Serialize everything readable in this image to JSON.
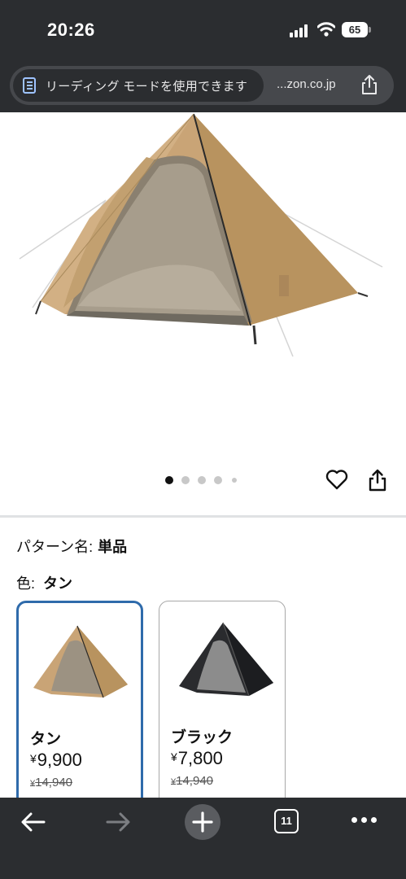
{
  "status_bar": {
    "time": "20:26",
    "battery": "65",
    "icons": [
      "signal-icon",
      "wifi-icon",
      "battery-icon"
    ]
  },
  "address_bar": {
    "reader_mode_label": "リーディング モードを使用できます",
    "domain": "...zon.co.jp",
    "icons": [
      "reader-mode-icon",
      "share-icon"
    ]
  },
  "product": {
    "image": "tent-image",
    "carousel": {
      "count": 5,
      "active_index": 0
    },
    "actions": [
      "heart-icon",
      "share-icon"
    ]
  },
  "details": {
    "pattern_label": "パターン名:",
    "pattern_value": "単品",
    "color_label": "色:",
    "color_value": "タン"
  },
  "variants": [
    {
      "name": "タン",
      "currency": "¥",
      "price": "9,900",
      "list_currency": "¥",
      "list_price": "14,940",
      "selected": true,
      "tent_color": "#c9a476"
    },
    {
      "name": "ブラック",
      "currency": "¥",
      "price": "7,800",
      "list_currency": "¥",
      "list_price": "14,940",
      "selected": false,
      "tent_color": "#2a2b2e"
    }
  ],
  "toolbar": {
    "tab_count": "11",
    "icons": [
      "back-arrow-icon",
      "forward-arrow-icon",
      "new-tab-plus-icon",
      "tabs-icon",
      "more-icon"
    ]
  },
  "colors": {
    "chrome_bg": "#2b2d30",
    "selected_border": "#2f6bab",
    "tent_tan": "#c9a476"
  }
}
